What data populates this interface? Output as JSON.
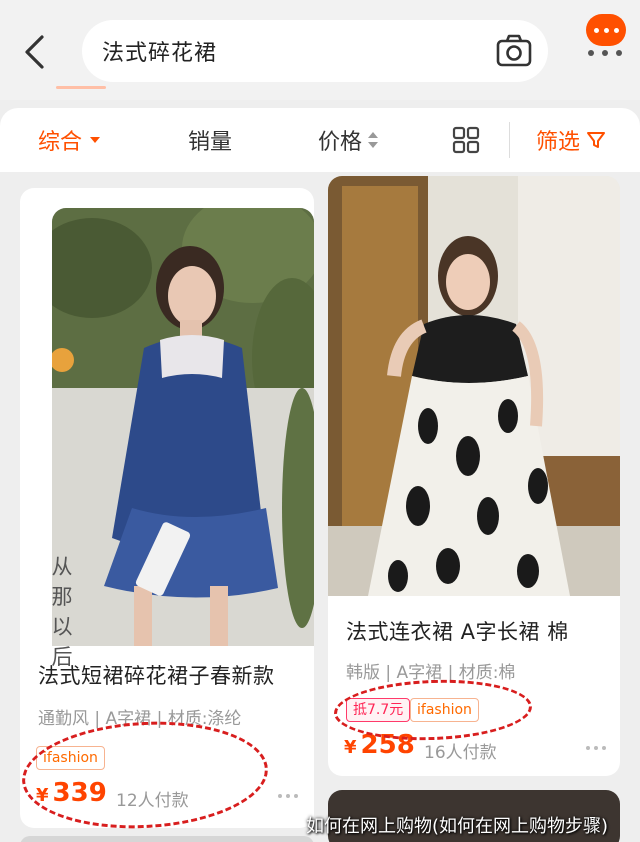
{
  "header": {
    "search_query": "法式碎花裙"
  },
  "sort_bar": {
    "comprehensive": "综合",
    "sales": "销量",
    "price": "价格",
    "filter": "筛选"
  },
  "products": [
    {
      "overlay_text": "从那以后",
      "title": "法式短裙碎花裙子春新款",
      "attributes": "通勤风 | A字裙 | 材质:涤纶",
      "tags": [
        "ifashion"
      ],
      "currency": "¥",
      "price": "339",
      "sales": "12人付款"
    },
    {
      "title": "法式连衣裙 A字长裙 棉",
      "attributes": "韩版 | A字裙 | 材质:棉",
      "tags": [
        "抵7.7元",
        "ifashion"
      ],
      "currency": "¥",
      "price": "258",
      "sales": "16人付款"
    }
  ],
  "watermark": "如何在网上购物(如何在网上购物步骤)",
  "colors": {
    "accent": "#ff5000",
    "price": "#ff4400",
    "annotation": "#d81e1e"
  },
  "icons": [
    "back-arrow-icon",
    "camera-icon",
    "message-icon",
    "more-icon",
    "caret-down-icon",
    "sort-arrows-icon",
    "grid-view-icon",
    "filter-funnel-icon"
  ]
}
